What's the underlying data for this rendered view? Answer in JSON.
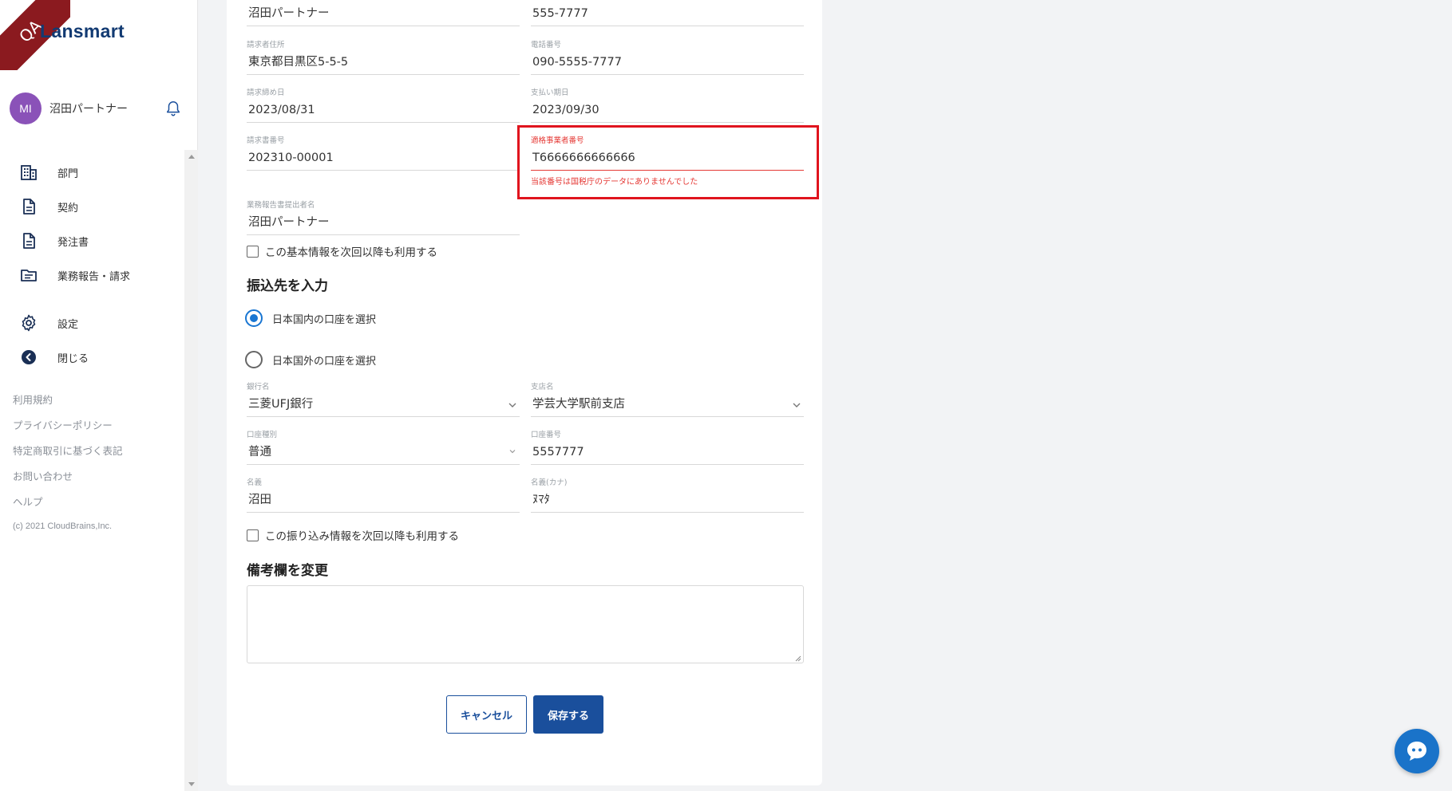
{
  "app": {
    "logo_text": "Lansmart",
    "ribbon_text": "QA"
  },
  "user": {
    "initials": "MI",
    "name": "沼田パートナー"
  },
  "sidebar": {
    "items": [
      {
        "label": "部門",
        "icon": "building-icon"
      },
      {
        "label": "契約",
        "icon": "document-icon"
      },
      {
        "label": "発注書",
        "icon": "document-icon"
      },
      {
        "label": "業務報告・請求",
        "icon": "folder-icon"
      },
      {
        "label": "設定",
        "icon": "gear-icon"
      },
      {
        "label": "閉じる",
        "icon": "back-arrow-icon"
      }
    ],
    "links": [
      "利用規約",
      "プライバシーポリシー",
      "特定商取引に基づく表記",
      "お問い合わせ",
      "ヘルプ"
    ],
    "copyright": "(c) 2021 CloudBrains,Inc."
  },
  "form": {
    "fields": {
      "company_name": {
        "label": "",
        "value": "沼田パートナー"
      },
      "contact_phone_top": {
        "label": "",
        "value": "555-7777"
      },
      "billing_address": {
        "label": "請求者住所",
        "value": "東京都目黒区5-5-5"
      },
      "phone": {
        "label": "電話番号",
        "value": "090-5555-7777"
      },
      "closing_date": {
        "label": "請求締め日",
        "value": "2023/08/31"
      },
      "payment_date": {
        "label": "支払い期日",
        "value": "2023/09/30"
      },
      "invoice_number": {
        "label": "請求書番号",
        "value": "202310-00001"
      },
      "registration_number": {
        "label": "適格事業者番号",
        "value": "T6666666666666",
        "error": "当該番号は国税庁のデータにありませんでした"
      },
      "report_submitter": {
        "label": "業務報告書提出者名",
        "value": "沼田パートナー"
      },
      "bank_name": {
        "label": "銀行名",
        "value": "三菱UFJ銀行"
      },
      "branch_name": {
        "label": "支店名",
        "value": "学芸大学駅前支店"
      },
      "account_type": {
        "label": "口座種別",
        "value": "普通"
      },
      "account_number": {
        "label": "口座番号",
        "value": "5557777"
      },
      "account_holder": {
        "label": "名義",
        "value": "沼田"
      },
      "account_holder_kana": {
        "label": "名義(カナ)",
        "value": "ﾇﾏﾀ"
      }
    },
    "reuse_basic_label": "この基本情報を次回以降も利用する",
    "transfer_section_title": "振込先を入力",
    "radio_domestic": "日本国内の口座を選択",
    "radio_foreign": "日本国外の口座を選択",
    "reuse_transfer_label": "この振り込み情報を次回以降も利用する",
    "remarks_title": "備考欄を変更",
    "remarks_value": "",
    "cancel_label": "キャンセル",
    "save_label": "保存する"
  },
  "colors": {
    "brand": "#1a4f9c",
    "error": "#e53935",
    "highlight": "#e0141e",
    "avatar": "#8a52b8",
    "radio": "#1976d2"
  }
}
